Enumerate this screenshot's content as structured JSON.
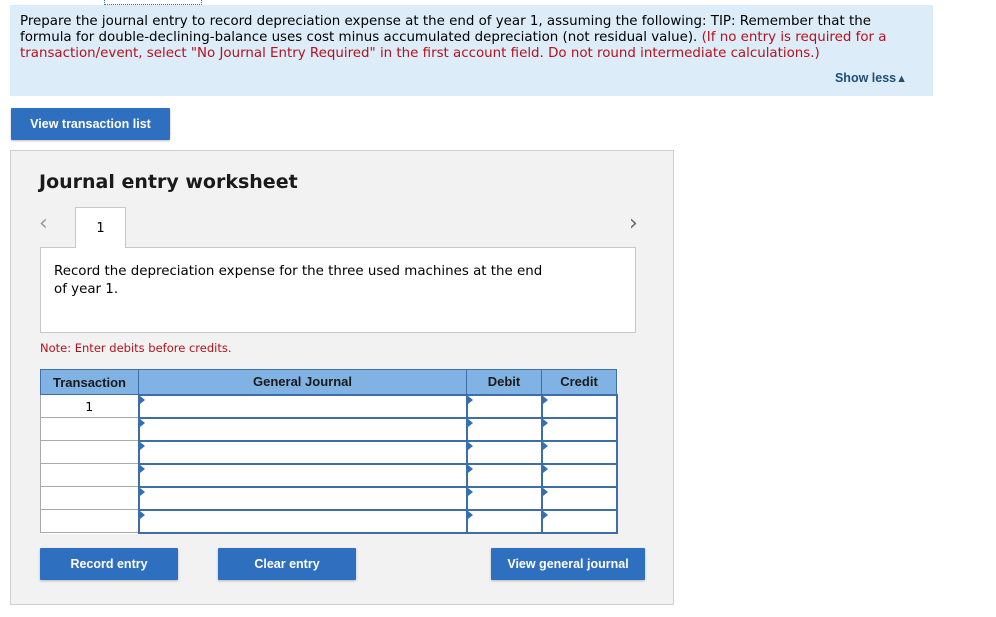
{
  "prompt": {
    "text_black": "Prepare the journal entry to record depreciation expense at the end of year 1, assuming the following: TIP: Remember that the formula for double-declining-balance uses cost minus accumulated depreciation (not residual value).",
    "text_red": "(If no entry is required for a transaction/event, select \"No Journal Entry Required\" in the first account field. Do not round intermediate calculations.)",
    "show_less_label": "Show less",
    "show_less_icon": "▲"
  },
  "buttons": {
    "view_transaction_list": "View transaction list",
    "record_entry": "Record entry",
    "clear_entry": "Clear entry",
    "view_general_journal": "View general journal"
  },
  "worksheet": {
    "title": "Journal entry worksheet",
    "nav_prev_icon": "‹",
    "nav_next_icon": "›",
    "tabs": [
      {
        "label": "1"
      }
    ],
    "description": "Record the depreciation expense for the three used machines at the end of year 1.",
    "note": "Note: Enter debits before credits."
  },
  "table": {
    "headers": [
      "Transaction",
      "General Journal",
      "Debit",
      "Credit"
    ],
    "rows": [
      {
        "transaction": "1",
        "general_journal": "",
        "debit": "",
        "credit": ""
      },
      {
        "transaction": "",
        "general_journal": "",
        "debit": "",
        "credit": ""
      },
      {
        "transaction": "",
        "general_journal": "",
        "debit": "",
        "credit": ""
      },
      {
        "transaction": "",
        "general_journal": "",
        "debit": "",
        "credit": ""
      },
      {
        "transaction": "",
        "general_journal": "",
        "debit": "",
        "credit": ""
      },
      {
        "transaction": "",
        "general_journal": "",
        "debit": "",
        "credit": ""
      }
    ]
  },
  "colors": {
    "accent": "#2f6fbf",
    "prompt_bg": "#dcecf8",
    "warning_red": "#b5111c",
    "table_header": "#80b2e3"
  }
}
